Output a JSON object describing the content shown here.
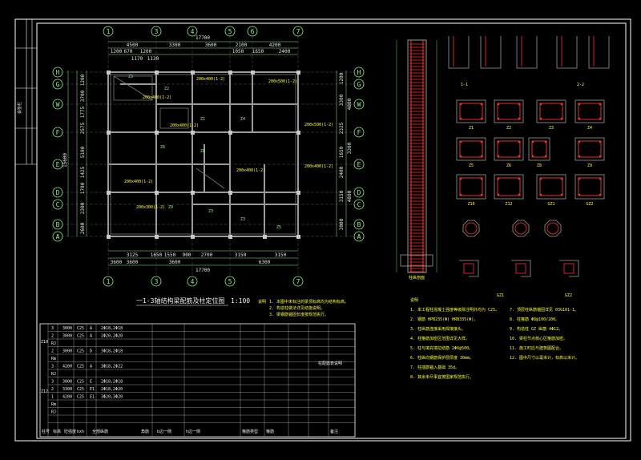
{
  "title_block": {
    "label": "会签栏"
  },
  "plan": {
    "title": "一1-3轴结构梁配筋及柱定位图",
    "scale": "1:100",
    "axes_top": [
      "1",
      "3",
      "4",
      "5",
      "6",
      "7"
    ],
    "axes_bottom": [
      "1",
      "3",
      "4",
      "5",
      "7"
    ],
    "axes_left": [
      "H",
      "G",
      "W",
      "F",
      "E",
      "D",
      "C",
      "B",
      "A"
    ],
    "top_total": "17700",
    "top_dims_1": [
      "4500",
      "3300",
      "3600",
      "2100",
      "4200"
    ],
    "top_dims_2": [
      "1200",
      "670",
      "1200",
      "1050",
      "1650",
      "2400"
    ],
    "top_dims_3": [
      "1170",
      "1130"
    ],
    "bottom_dims_1": [
      "3125",
      "1650",
      "1550",
      "900",
      "2700",
      "3150",
      "3150"
    ],
    "bottom_dims_2": [
      "3600",
      "3600",
      "3600",
      "6300"
    ],
    "bottom_total": "17700",
    "left_total": "15600",
    "left_dims": [
      "1200",
      "3700",
      "1775",
      "2575",
      "5100",
      "1425",
      "1700",
      "2300",
      "2600"
    ],
    "right_dims": [
      "1200",
      "3300",
      "2325",
      "1650",
      "2400",
      "3150",
      "3000"
    ],
    "right_dims_2": [
      "4800",
      "3300",
      "4800"
    ],
    "beam_labels": [
      "200x400(1-2)",
      "200x500(1-2)",
      "200x400(1-2)",
      "200x400(1-2)",
      "200x500(1-2)",
      "200x400(1-2)",
      "200x400(1-2)",
      "200x400(1-2)",
      "200x300(1-2)"
    ],
    "column_labels": [
      "Z3",
      "Z2",
      "Z1",
      "Z4",
      "Z6",
      "Z8",
      "Z9",
      "Z3",
      "Z3",
      "Z5"
    ]
  },
  "plan_notes": {
    "title": "说明",
    "items": [
      "1. 本图中未标注的梁顶标高均为结构标高。",
      "2. 构造柱做法详见结施说明。",
      "3. 梁钢筋锚固长度按规范执行。"
    ]
  },
  "column_table": {
    "group_labels": [
      "Z10",
      "Z12"
    ],
    "rows": [
      [
        "3",
        "3000",
        "C25",
        "A",
        "2Φ18,2Φ18"
      ],
      [
        "2",
        "3000",
        "C25",
        "A",
        "2Φ20,2Φ20"
      ],
      [
        "RJ",
        "",
        "",
        "",
        ""
      ],
      [
        "2",
        "3000",
        "C25",
        "D",
        "3Φ18,2Φ18"
      ],
      [
        "Rm",
        "",
        "",
        "",
        ""
      ],
      [
        "3",
        "4200",
        "C25",
        "A",
        "3Φ18,2Φ22"
      ],
      [
        "RJ",
        "",
        "",
        "",
        ""
      ],
      [
        "3",
        "3000",
        "C25",
        "E",
        "2Φ18,2Φ18"
      ],
      [
        "2",
        "3300",
        "C25",
        "E1",
        "2Φ18,2Φ20"
      ],
      [
        "1",
        "4200",
        "C25",
        "E1",
        "3Φ20,3Φ20"
      ],
      [
        "Rm",
        "",
        "",
        "",
        ""
      ],
      [
        "RJ",
        "",
        "",
        "",
        ""
      ]
    ],
    "header": [
      "柱号",
      "标高",
      "砼强度",
      "bxh",
      "全部纵筋",
      "角筋",
      "b边一侧",
      "h边一侧",
      "箍筋类型",
      "箍筋",
      "备注"
    ],
    "remark": "柱配筋表说明"
  },
  "notes": {
    "title": "说明",
    "left": [
      "1. 本工程柱混凝土强度等级除注明外均为 C25。",
      "2. 钢筋 HPB235(Φ) HRB335(Φ)。",
      "3. 柱纵筋连接采用焊接接头。",
      "4. 柱箍筋加密区范围详见大样。",
      "5. 柱与填充墙拉结筋 2Φ6@500。",
      "6. 柱纵向钢筋保护层厚度 30mm。",
      "7. 柱插筋锚入基础 35d。",
      "8. 其余未尽事宜按国家规范执行。"
    ],
    "right": [
      "7. 顶层柱纵筋锚固详见 03G101-1。",
      "8. 柱箍筋 Φ8@100/200。",
      "9. 构造柱 GZ 纵筋 4Φ12。",
      "10. 梁柱节点核心区箍筋加密。",
      "11. 施工时应与建筑图配合。",
      "12. 图中尺寸以毫米计，标高以米计。"
    ]
  },
  "section_labels": [
    "柱纵剖面",
    "1-1",
    "2-2",
    "Z1",
    "Z2",
    "Z3",
    "Z4",
    "Z5",
    "Z6",
    "Z8",
    "Z9",
    "Z10",
    "Z12",
    "GZ1",
    "GZ2"
  ],
  "colors": {
    "background": "#000000",
    "frame": "#ffffff",
    "wall": "#8c8c8c",
    "rebar": "#ff3030",
    "dim": "#8ef08e",
    "text": "#ffff40"
  }
}
